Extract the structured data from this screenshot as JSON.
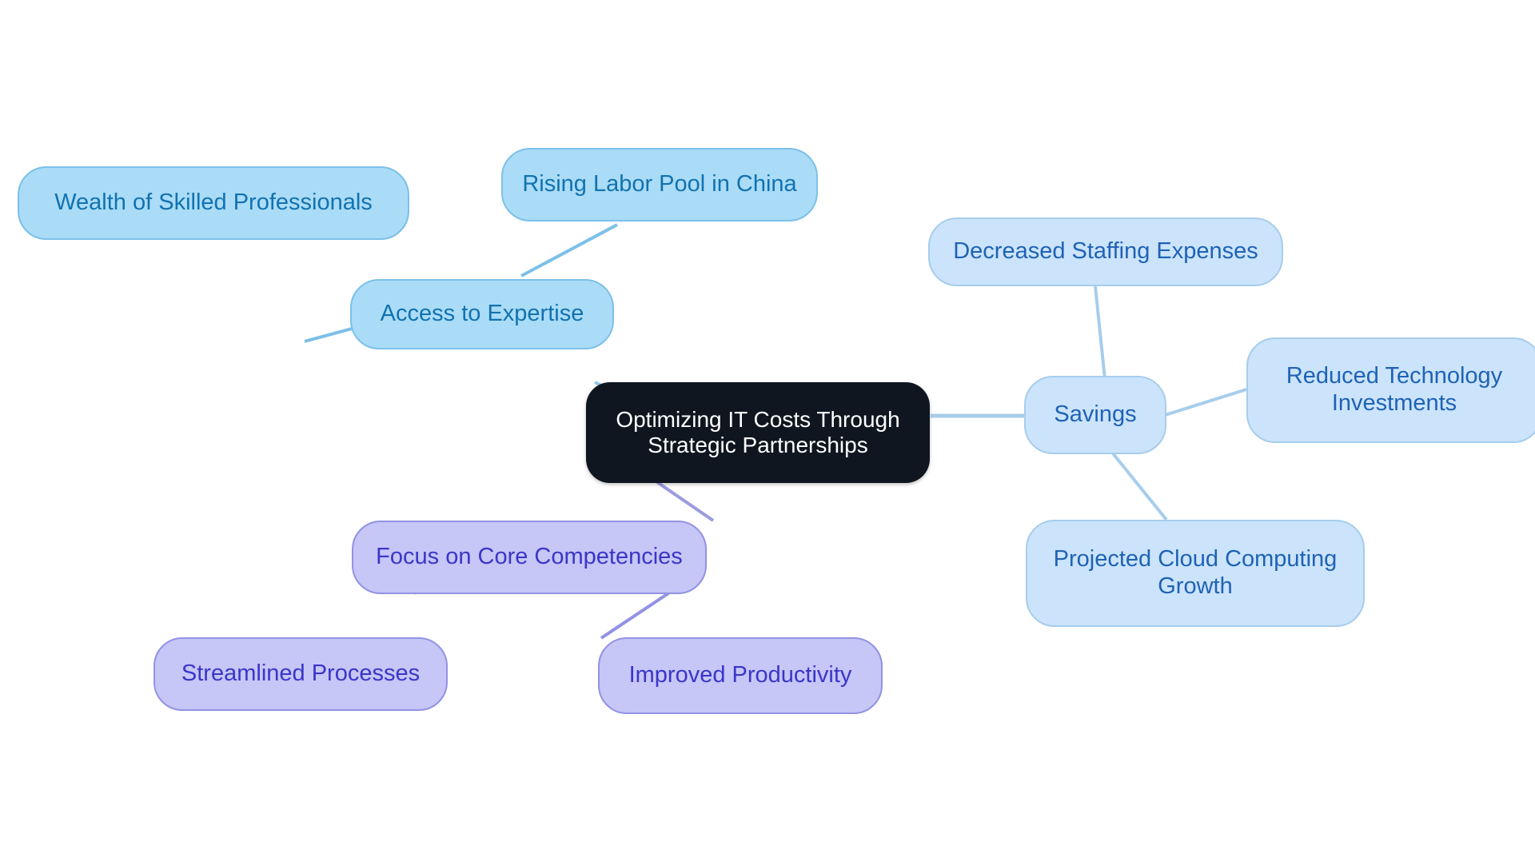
{
  "diagram": {
    "type": "mindmap",
    "title": "Optimizing IT Costs Through Strategic Partnerships",
    "background_color": "#ffffff",
    "palette": {
      "root_fill": "#0f1620",
      "root_text": "#ffffff",
      "blue_mid_fill": "#aadcf7",
      "blue_mid_border": "#7cc0e8",
      "blue_mid_text": "#1272b0",
      "blue_light_fill": "#cbe4fb",
      "blue_light_border": "#a7cdec",
      "blue_light_text": "#1f62b6",
      "purple_fill": "#c6c6f7",
      "purple_border": "#9292e4",
      "purple_text": "#3a36c8",
      "edge_blue": "#93c5e8",
      "edge_light_blue": "#a7cdec",
      "edge_purple": "#9b9be0"
    }
  },
  "nodes": {
    "root": {
      "label": "Optimizing IT Costs Through\nStrategic Partnerships"
    },
    "branch_expertise": {
      "label": "Access to Expertise"
    },
    "branch_savings": {
      "label": "Savings"
    },
    "branch_core": {
      "label": "Focus on Core Competencies"
    },
    "leaf_wealth": {
      "label": "Wealth of Skilled Professionals"
    },
    "leaf_labor": {
      "label": "Rising Labor Pool in China"
    },
    "leaf_staffing": {
      "label": "Decreased Staffing Expenses"
    },
    "leaf_tech": {
      "label": "Reduced Technology\nInvestments"
    },
    "leaf_cloud": {
      "label": "Projected Cloud Computing\nGrowth"
    },
    "leaf_processes": {
      "label": "Streamlined Processes"
    },
    "leaf_productivity": {
      "label": "Improved Productivity"
    }
  },
  "edges": [
    {
      "from": "root",
      "to": "branch_expertise",
      "color": "#93c5e8"
    },
    {
      "from": "root",
      "to": "branch_savings",
      "color": "#a7cdec"
    },
    {
      "from": "root",
      "to": "branch_core",
      "color": "#9b9be0"
    },
    {
      "from": "branch_expertise",
      "to": "leaf_wealth",
      "color": "#7cc0e8"
    },
    {
      "from": "branch_expertise",
      "to": "leaf_labor",
      "color": "#7cc0e8"
    },
    {
      "from": "branch_savings",
      "to": "leaf_staffing",
      "color": "#a7cdec"
    },
    {
      "from": "branch_savings",
      "to": "leaf_tech",
      "color": "#a7cdec"
    },
    {
      "from": "branch_savings",
      "to": "leaf_cloud",
      "color": "#a7cdec"
    },
    {
      "from": "branch_core",
      "to": "leaf_processes",
      "color": "#9292e4"
    },
    {
      "from": "branch_core",
      "to": "leaf_productivity",
      "color": "#9292e4"
    }
  ]
}
